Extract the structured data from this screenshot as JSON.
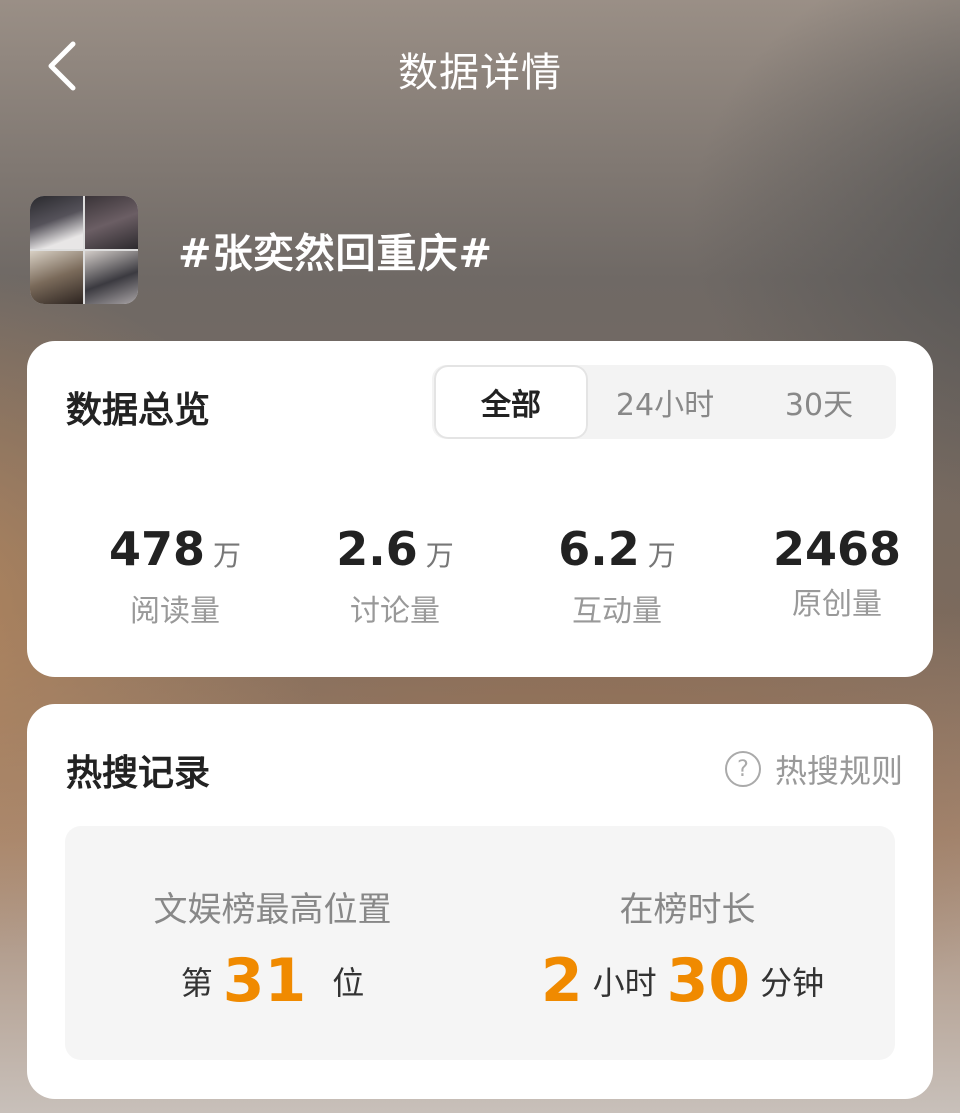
{
  "header": {
    "title": "数据详情",
    "back_icon": "chevron-left-icon"
  },
  "topic": {
    "title": "#张奕然回重庆#"
  },
  "overview": {
    "title": "数据总览",
    "tabs": [
      {
        "label": "全部",
        "active": true
      },
      {
        "label": "24小时",
        "active": false
      },
      {
        "label": "30天",
        "active": false
      }
    ],
    "stats": [
      {
        "value": "478",
        "unit": "万",
        "label": "阅读量"
      },
      {
        "value": "2.6",
        "unit": "万",
        "label": "讨论量"
      },
      {
        "value": "6.2",
        "unit": "万",
        "label": "互动量"
      },
      {
        "value": "2468",
        "unit": "",
        "label": "原创量"
      }
    ]
  },
  "hot_search": {
    "title": "热搜记录",
    "rules_label": "热搜规则",
    "rules_icon": "question-circle-icon",
    "best_position": {
      "label": "文娱榜最高位置",
      "prefix": "第",
      "value": "31",
      "suffix": "位"
    },
    "duration": {
      "label": "在榜时长",
      "hours": "2",
      "hours_unit": "小时",
      "minutes": "30",
      "minutes_unit": "分钟"
    }
  },
  "colors": {
    "accent": "#f08a00",
    "card_bg": "#ffffff",
    "muted": "#999999"
  }
}
